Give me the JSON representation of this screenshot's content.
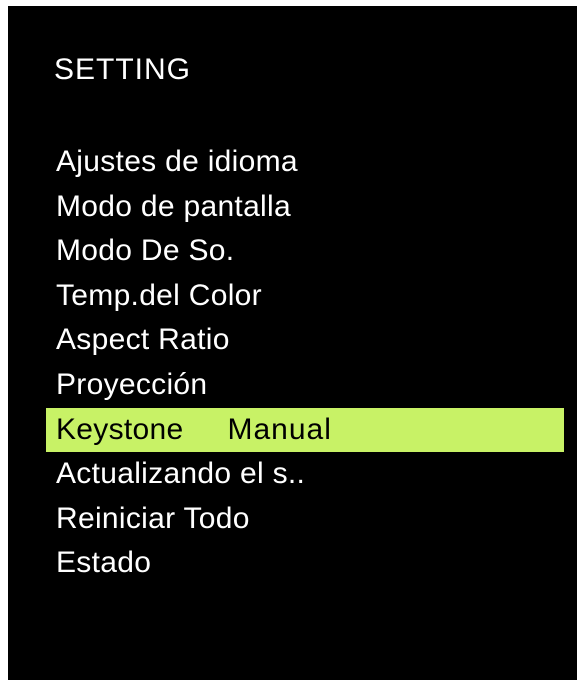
{
  "screen": {
    "title": "SETTING"
  },
  "menu": {
    "items": [
      {
        "label": "Ajustes de idioma",
        "value": ""
      },
      {
        "label": "Modo de pantalla",
        "value": ""
      },
      {
        "label": "Modo De So.",
        "value": ""
      },
      {
        "label": "Temp.del Color",
        "value": ""
      },
      {
        "label": "Aspect Ratio",
        "value": ""
      },
      {
        "label": "Proyección",
        "value": ""
      },
      {
        "label": "Keystone",
        "value": "Manual"
      },
      {
        "label": "Actualizando el s..",
        "value": ""
      },
      {
        "label": "Reiniciar Todo",
        "value": ""
      },
      {
        "label": "Estado",
        "value": ""
      }
    ],
    "selected_index": 6
  },
  "colors": {
    "background": "#000000",
    "text": "#ffffff",
    "highlight": "#c8f266",
    "highlight_text": "#000000"
  }
}
